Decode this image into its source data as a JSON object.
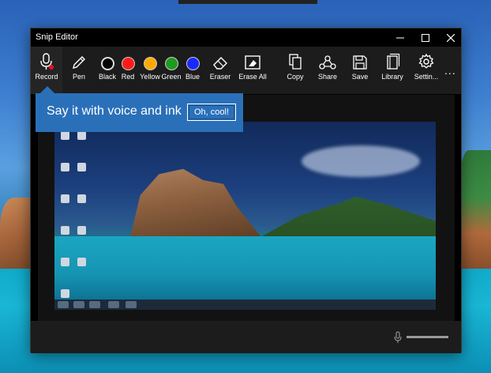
{
  "window": {
    "title": "Snip Editor"
  },
  "toolbar": {
    "tools": [
      {
        "label": "Record",
        "icon": "microphone-icon"
      },
      {
        "label": "Pen",
        "icon": "pen-icon"
      },
      {
        "label": "Black",
        "icon": "color-swatch",
        "color": "#000000"
      },
      {
        "label": "Red",
        "icon": "color-swatch",
        "color": "#ff1a1a"
      },
      {
        "label": "Yellow",
        "icon": "color-swatch",
        "color": "#ffaa00"
      },
      {
        "label": "Green",
        "icon": "color-swatch",
        "color": "#1f9a1f"
      },
      {
        "label": "Blue",
        "icon": "color-swatch",
        "color": "#1a2aff"
      },
      {
        "label": "Eraser",
        "icon": "eraser-icon"
      },
      {
        "label": "Erase All",
        "icon": "erase-all-icon"
      },
      {
        "label": "Copy",
        "icon": "copy-icon"
      },
      {
        "label": "Share",
        "icon": "share-icon"
      },
      {
        "label": "Save",
        "icon": "save-icon"
      },
      {
        "label": "Library",
        "icon": "library-icon"
      },
      {
        "label": "Settin...",
        "icon": "gear-icon"
      }
    ],
    "more": "..."
  },
  "callout": {
    "message": "Say it with voice and ink",
    "button": "Oh, cool!",
    "color": "#2a70b9"
  },
  "accent": "#2a70b9"
}
